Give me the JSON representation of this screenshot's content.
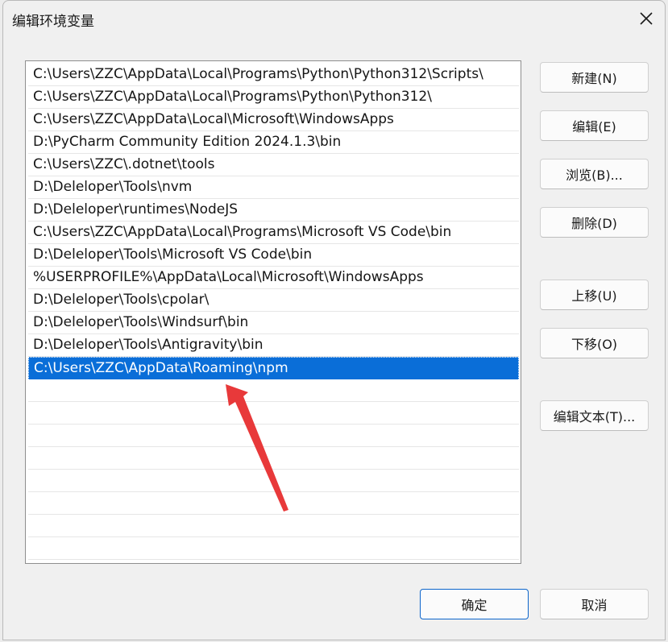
{
  "dialog": {
    "title": "编辑环境变量",
    "close_icon": "close-icon"
  },
  "path_list": {
    "entries": [
      "C:\\Users\\ZZC\\AppData\\Local\\Programs\\Python\\Python312\\Scripts\\",
      "C:\\Users\\ZZC\\AppData\\Local\\Programs\\Python\\Python312\\",
      "C:\\Users\\ZZC\\AppData\\Local\\Microsoft\\WindowsApps",
      "D:\\PyCharm Community Edition 2024.1.3\\bin",
      "C:\\Users\\ZZC\\.dotnet\\tools",
      "D:\\Deleloper\\Tools\\nvm",
      "D:\\Deleloper\\runtimes\\NodeJS",
      "C:\\Users\\ZZC\\AppData\\Local\\Programs\\Microsoft VS Code\\bin",
      "D:\\Deleloper\\Tools\\Microsoft VS Code\\bin",
      "%USERPROFILE%\\AppData\\Local\\Microsoft\\WindowsApps",
      "D:\\Deleloper\\Tools\\cpolar\\",
      "D:\\Deleloper\\Tools\\Windsurf\\bin",
      "D:\\Deleloper\\Tools\\Antigravity\\bin",
      "C:\\Users\\ZZC\\AppData\\Roaming\\npm"
    ],
    "selected_index": 13,
    "selection_color": "#0a6ed8"
  },
  "side_buttons": {
    "new": "新建(N)",
    "edit": "编辑(E)",
    "browse": "浏览(B)...",
    "delete": "删除(D)",
    "move_up": "上移(U)",
    "move_down": "下移(O)",
    "edit_text": "编辑文本(T)..."
  },
  "footer": {
    "ok": "确定",
    "cancel": "取消"
  },
  "annotation": {
    "arrow_color": "#e8393a"
  }
}
